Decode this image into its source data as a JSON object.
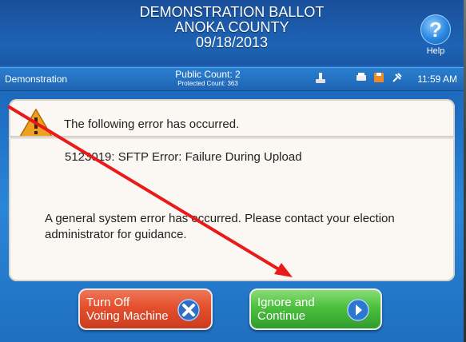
{
  "header": {
    "title_line1": "DEMONSTRATION BALLOT",
    "title_line2": "ANOKA COUNTY",
    "date": "09/18/2013",
    "help_label": "Help",
    "help_glyph": "?"
  },
  "status_bar": {
    "mode": "Demonstration",
    "public_count": "Public Count: 2",
    "protected_count": "Protected Count: 363",
    "time": "11:59 AM",
    "icons": [
      "usb-icon",
      "printer-icon",
      "memory-card-icon",
      "plug-icon"
    ]
  },
  "dialog": {
    "heading": "The following error has occurred.",
    "error_code": "5123019: SFTP Error: Failure During Upload",
    "message": "A general system error has occurred.  Please contact your election administrator for guidance."
  },
  "buttons": {
    "turn_off_line1": "Turn Off",
    "turn_off_line2": "Voting Machine",
    "continue_line1": "Ignore and",
    "continue_line2": "Continue"
  },
  "colors": {
    "screen_blue": "#1f6fc4",
    "warning_orange": "#f0a020",
    "button_red": "#e4502e",
    "button_green": "#4cc03e",
    "annotation_arrow": "#e81a1a"
  }
}
